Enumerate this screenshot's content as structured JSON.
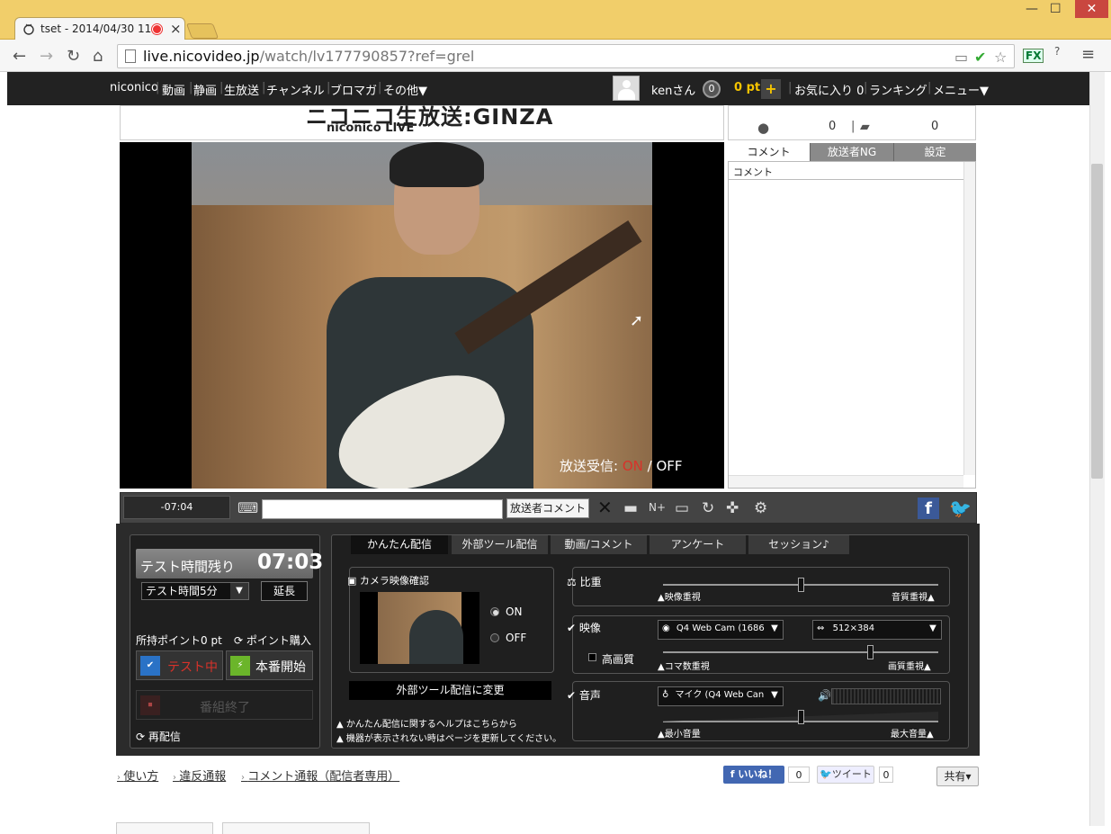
{
  "browser": {
    "tab_title": "tset - 2014/04/30 11",
    "tab_close": "×",
    "url_host": "live.nicovideo.jp",
    "url_path": "/watch/lv177790857?ref=grel",
    "back": "←",
    "forward": "→",
    "reload": "↻",
    "home": "⌂",
    "menu": "≡",
    "win_min": "—",
    "win_max": "☐",
    "win_close": "✕",
    "ext_fx": "FX",
    "ext_help": "?"
  },
  "nicobar": {
    "items": [
      "niconico",
      "動画",
      "静画",
      "生放送",
      "チャンネル",
      "ブロマガ",
      "その他▼"
    ],
    "separator": "|",
    "user": "kenさん",
    "notif_count": "0",
    "points": "0 pt",
    "plus": "+",
    "favorites": "お気に入り 0",
    "ranking": "ランキング",
    "menu": "メニュー▼"
  },
  "player": {
    "logo_top": "ニコニコ生放送:GINZA",
    "logo_bottom": "niconico LIVE",
    "receive_label": "放送受信:",
    "receive_on": "ON",
    "receive_sep": "/",
    "receive_off": "OFF"
  },
  "right_panel": {
    "viewers": "0",
    "comments": "0",
    "tabs": [
      "コメント",
      "放送者NG",
      "設定"
    ],
    "column_header": "コメント"
  },
  "control_bar": {
    "time": "-07:04",
    "comment_placeholder": "",
    "broadcaster_comment": "放送者コメント"
  },
  "broadcast": {
    "test_label": "テスト時間残り",
    "test_time": "07:03",
    "test_select": "テスト時間5分",
    "extend": "延長",
    "held_points": "所持ポイント0 pt",
    "buy_points": "ポイント購入",
    "testing": "テスト中",
    "start": "本番開始",
    "end": "番組終了",
    "rebroadcast": "再配信",
    "tabs": [
      "かんたん配信",
      "外部ツール配信",
      "動画/コメント",
      "アンケート",
      "セッション♪"
    ],
    "camera_check": "カメラ映像確認",
    "cam_on": "ON",
    "cam_off": "OFF",
    "switch_external": "外部ツール配信に変更",
    "help1": "かんたん配信に関するヘルプはこちらから",
    "help2": "機器が表示されない時はページを更新してください。",
    "weight_label": "比重",
    "weight_left": "映像重視",
    "weight_right": "音質重視",
    "weight_value": 0.5,
    "video_label": "映像",
    "video_device": "Q4 Web Cam (1686",
    "video_size": "512×384",
    "hq_label": "高画質",
    "frame_left": "コマ数重視",
    "frame_right": "画質重視",
    "frame_value": 0.75,
    "audio_label": "音声",
    "audio_device": "マイク (Q4 Web Can",
    "vol_left": "最小音量",
    "vol_right": "最大音量",
    "vol_value": 0.5
  },
  "footer": {
    "links": [
      "使い方",
      "違反通報",
      "コメント通報（配信者専用）"
    ],
    "like": "いいね！",
    "like_count": "0",
    "tweet": "ツイート",
    "tweet_count": "0",
    "share": "共有▾"
  }
}
